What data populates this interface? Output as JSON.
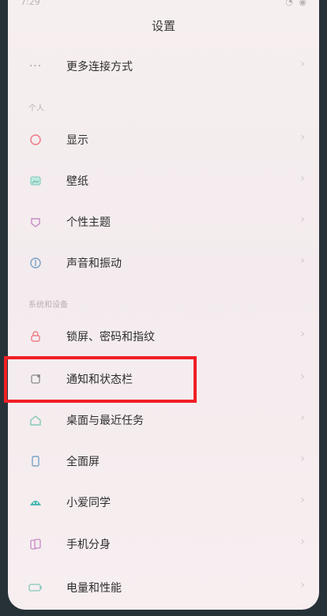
{
  "status": {
    "time": "7:29",
    "icons": "◔ ◉"
  },
  "header": {
    "title": "设置"
  },
  "sections": {
    "personal": "个人",
    "system": "系统和设备"
  },
  "rows": [
    {
      "label": "更多连接方式",
      "icon": "more-dots-icon"
    },
    {
      "label": "显示",
      "icon": "display-icon"
    },
    {
      "label": "壁纸",
      "icon": "wallpaper-icon"
    },
    {
      "label": "个性主题",
      "icon": "theme-icon"
    },
    {
      "label": "声音和振动",
      "icon": "sound-icon"
    },
    {
      "label": "锁屏、密码和指纹",
      "icon": "lock-icon"
    },
    {
      "label": "通知和状态栏",
      "icon": "notification-icon"
    },
    {
      "label": "桌面与最近任务",
      "icon": "home-icon"
    },
    {
      "label": "全面屏",
      "icon": "fullscreen-icon"
    },
    {
      "label": "小爱同学",
      "icon": "assistant-icon"
    },
    {
      "label": "手机分身",
      "icon": "dual-phone-icon"
    },
    {
      "label": "电量和性能",
      "icon": "battery-icon"
    }
  ],
  "chevron": "›",
  "colors": {
    "highlight": "#f01f26"
  }
}
